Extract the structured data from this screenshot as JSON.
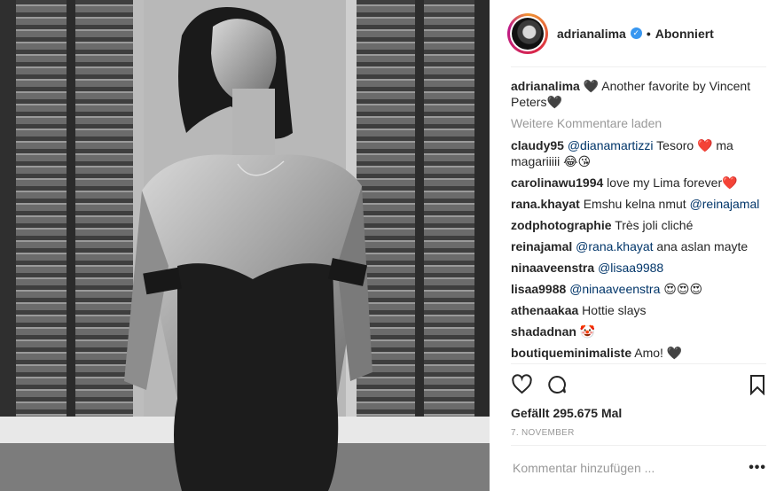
{
  "header": {
    "username": "adrianalima",
    "verified_icon": "verified-check-icon",
    "separator": "•",
    "follow_status": "Abonniert"
  },
  "caption": {
    "user": "adrianalima",
    "text": "🖤 Another favorite by Vincent Peters🖤"
  },
  "load_more": "Weitere Kommentare laden",
  "comments": [
    {
      "user": "claudy95",
      "mention": "@dianamartizzi",
      "text": " Tesoro ❤️ ma magariiiii 😂😘"
    },
    {
      "user": "carolinawu1994",
      "mention": "",
      "text": "love my Lima forever❤️"
    },
    {
      "user": "rana.khayat",
      "mention": "",
      "text": "Emshu kelna nmut ",
      "mention_after": "@reinajamal"
    },
    {
      "user": "zodphotographie",
      "mention": "",
      "text": "Très joli cliché"
    },
    {
      "user": "reinajamal",
      "mention": "@rana.khayat",
      "text": " ana aslan mayte"
    },
    {
      "user": "ninaaveenstra",
      "mention": "@lisaa9988",
      "text": ""
    },
    {
      "user": "lisaa9988",
      "mention": "@ninaaveenstra",
      "text": " 😍😍😍"
    },
    {
      "user": "athenaakaa",
      "mention": "",
      "text": "Hottie slays"
    },
    {
      "user": "shadadnan",
      "mention": "",
      "text": "🤡"
    },
    {
      "user": "boutiqueminimaliste",
      "mention": "",
      "text": "Amo! 🖤"
    }
  ],
  "actions": {
    "like_icon": "heart-icon",
    "comment_icon": "comment-bubble-icon",
    "save_icon": "bookmark-icon"
  },
  "likes": "Gefällt 295.675 Mal",
  "date": "7. NOVEMBER",
  "add_comment": {
    "placeholder": "Kommentar hinzufügen ...",
    "more": "•••"
  }
}
